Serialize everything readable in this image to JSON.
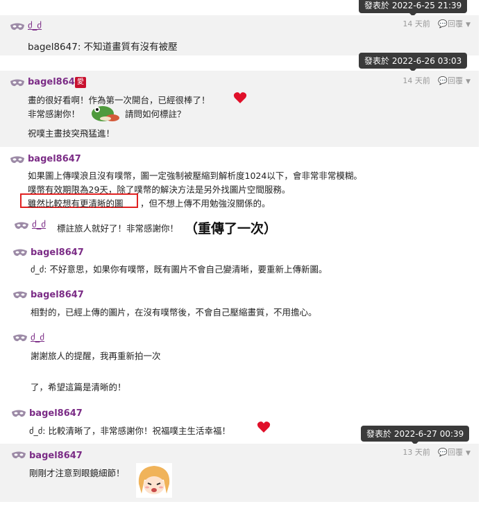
{
  "tooltips": [
    "發表於 2022-6-25 21:39",
    "發表於 2022-6-26 03:03",
    "發表於 2022-6-27 00:39"
  ],
  "badge": "愛",
  "posts": [
    {
      "user": "ძ_ძ",
      "meta": "14 天前",
      "reply": "回覆",
      "lines": [
        "bagel8647: 不知道畫質有沒有被壓"
      ]
    },
    {
      "user": "bagel8647",
      "meta": "14 天前",
      "reply": "回覆",
      "lines": [
        "畫的很好看啊！作為第一次開台，已經很棒了！",
        "非常感謝你！",
        "請問如何標註？",
        "祝噗主畫技突飛猛進！"
      ]
    },
    {
      "user": "bagel8647",
      "lines": [
        "如果圖上傳噗浪且沒有噗幣，圖一定強制被壓縮到解析度1024以下，會非常非常模糊。",
        "噗幣有效期限為29天，除了噗幣的解決方法是另外找圖片空間服務。",
        "雖然比較想有更清晰的圖",
        "，但不想上傳不用勉強沒關係的。"
      ]
    },
    {
      "user": "ძ_ძ",
      "lines": [
        "標註旅人就好了！非常感謝你！"
      ],
      "note": "（重傳了一次）"
    },
    {
      "user": "bagel8647",
      "lines": [
        "ძ_ძ: 不好意思，如果你有噗幣，既有圖片不會自己變清晰，要重新上傳新圖。"
      ]
    },
    {
      "user": "bagel8647",
      "lines": [
        "相對的，已經上傳的圖片，在沒有噗幣後，不會自己壓縮畫質，不用擔心。"
      ]
    },
    {
      "user": "ძ_ძ",
      "lines": [
        "謝謝旅人的提醒，我再重新拍一次",
        "了，希望這篇是清晰的！"
      ]
    },
    {
      "user": "bagel8647",
      "lines": [
        "ძ_ძ: 比較清晰了，非常感謝你！祝福噗主生活幸福！"
      ]
    },
    {
      "user": "bagel8647",
      "meta": "13 天前",
      "reply": "回覆",
      "lines": [
        "剛剛才注意到眼鏡細節！"
      ]
    }
  ],
  "colors": {
    "username": "#7b2c86",
    "highlight": "#e02020",
    "heart": "#e0102a",
    "tooltip_bg": "#3a3a3a"
  }
}
